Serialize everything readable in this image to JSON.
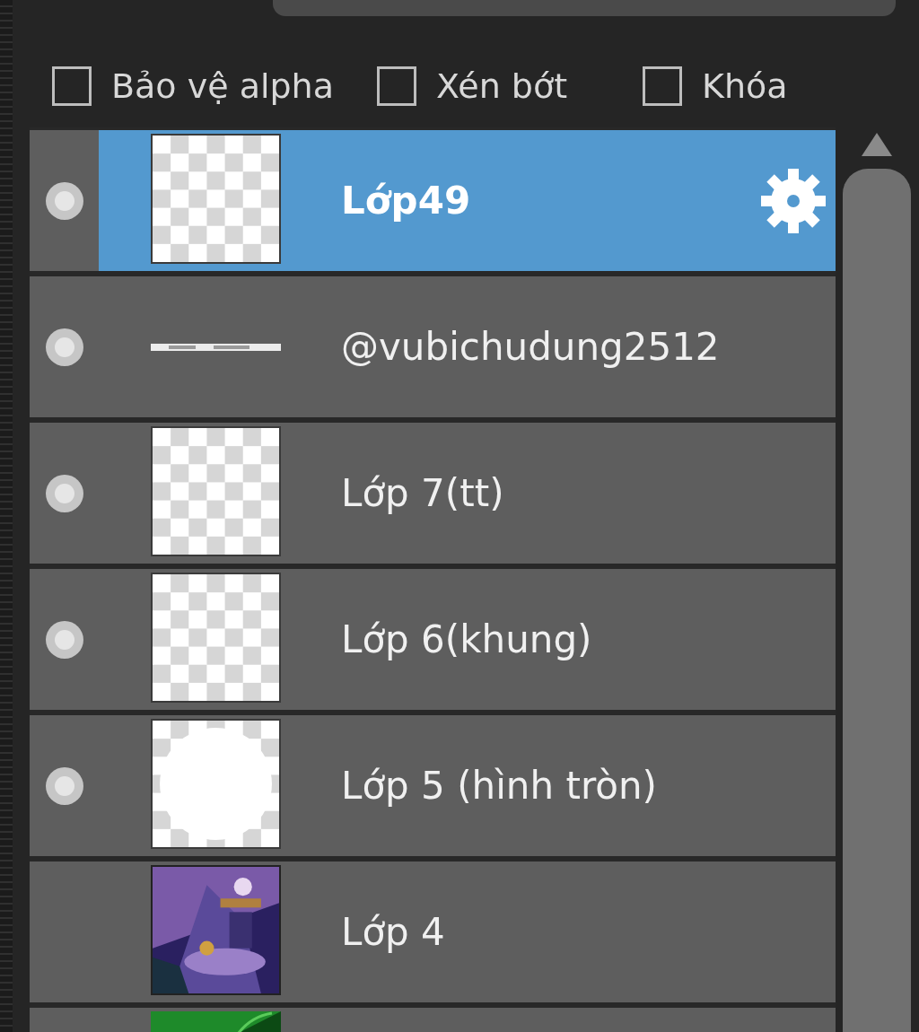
{
  "options": [
    {
      "label": "Bảo vệ alpha",
      "checked": false
    },
    {
      "label": "Xén bớt",
      "checked": false
    },
    {
      "label": "Khóa",
      "checked": false
    }
  ],
  "layers": [
    {
      "name": "Lớp49",
      "visible": true,
      "selected": true,
      "kind": "checker"
    },
    {
      "name": "@vubichudung2512",
      "visible": true,
      "selected": false,
      "kind": "watermark"
    },
    {
      "name": "Lớp 7(tt)",
      "visible": true,
      "selected": false,
      "kind": "checker"
    },
    {
      "name": "Lớp 6(khung)",
      "visible": true,
      "selected": false,
      "kind": "checker"
    },
    {
      "name": "Lớp 5 (hình tròn)",
      "visible": true,
      "selected": false,
      "kind": "circle"
    },
    {
      "name": "Lớp 4",
      "visible": false,
      "selected": false,
      "kind": "scene"
    },
    {
      "visible": false,
      "selected": false,
      "kind": "green"
    }
  ]
}
